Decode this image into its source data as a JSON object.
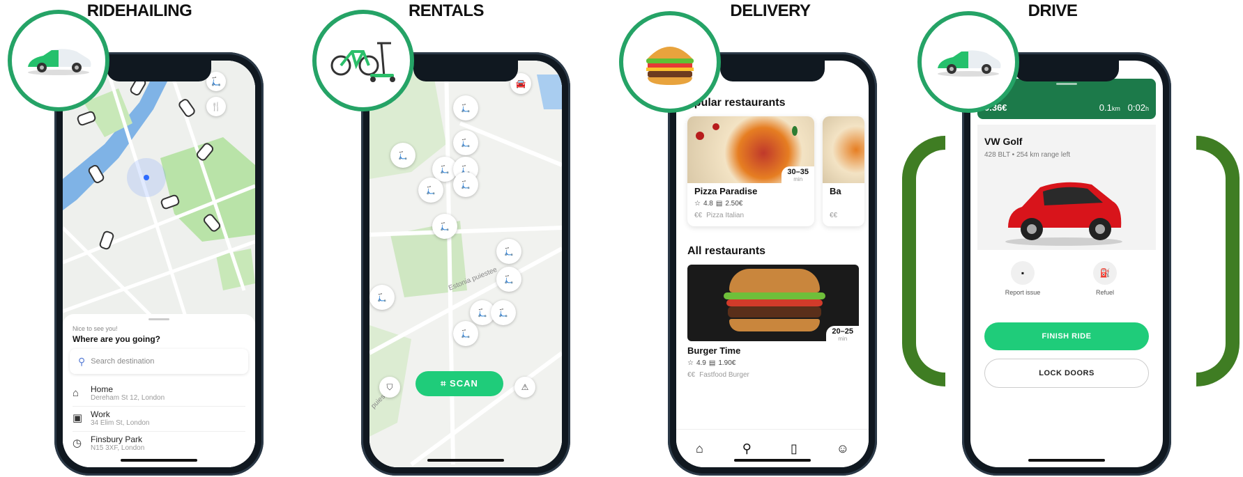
{
  "colors": {
    "accent": "#25a366",
    "button": "#1fcc7a",
    "bracket": "#3f7d23",
    "drive_header": "#1c7a4a"
  },
  "panels": {
    "ridehailing": {
      "title": "RIDEHAILING",
      "greeting": "Nice to see you!",
      "question": "Where are you going?",
      "search_placeholder": "Search destination",
      "places": [
        {
          "name": "Home",
          "address": "Dereham St 12, London",
          "icon": "home-icon"
        },
        {
          "name": "Work",
          "address": "34 Elim St, London",
          "icon": "briefcase-icon"
        },
        {
          "name": "Finsbury Park",
          "address": "N15 3XF, London",
          "icon": "clock-icon"
        }
      ]
    },
    "rentals": {
      "title": "RENTALS",
      "street_label": "Estonia puiestee",
      "street_label_2": "puiestee",
      "scan_label": "SCAN"
    },
    "delivery": {
      "title": "DELIVERY",
      "popular_heading": "opular restaurants",
      "popular": [
        {
          "name": "Pizza Paradise",
          "rating": "4.8",
          "fee": "2.50€",
          "price": "€€",
          "tags": "Pizza  Italian",
          "eta": "30–35",
          "eta_unit": "min"
        },
        {
          "name": "Ba",
          "rating": "",
          "fee": "",
          "price": "€€",
          "tags": "",
          "eta": "",
          "eta_unit": ""
        }
      ],
      "all_heading": "All restaurants",
      "all": [
        {
          "name": "Burger Time",
          "rating": "4.9",
          "fee": "1.90€",
          "price": "€€",
          "tags": "Fastfood  Burger",
          "eta": "20–25",
          "eta_unit": "min"
        }
      ],
      "nav": [
        "home-icon",
        "search-icon",
        "receipt-icon",
        "profile-icon"
      ]
    },
    "drive": {
      "title": "DRIVE",
      "price": "0.36€",
      "distance_value": "0.1",
      "distance_unit": "km",
      "time_value": "0:02",
      "time_unit": "h",
      "car_name": "VW Golf",
      "car_sub": "428 BLT • 254 km range left",
      "report_label": "Report issue",
      "refuel_label": "Refuel",
      "finish_label": "FINISH RIDE",
      "lock_label": "LOCK DOORS"
    }
  }
}
